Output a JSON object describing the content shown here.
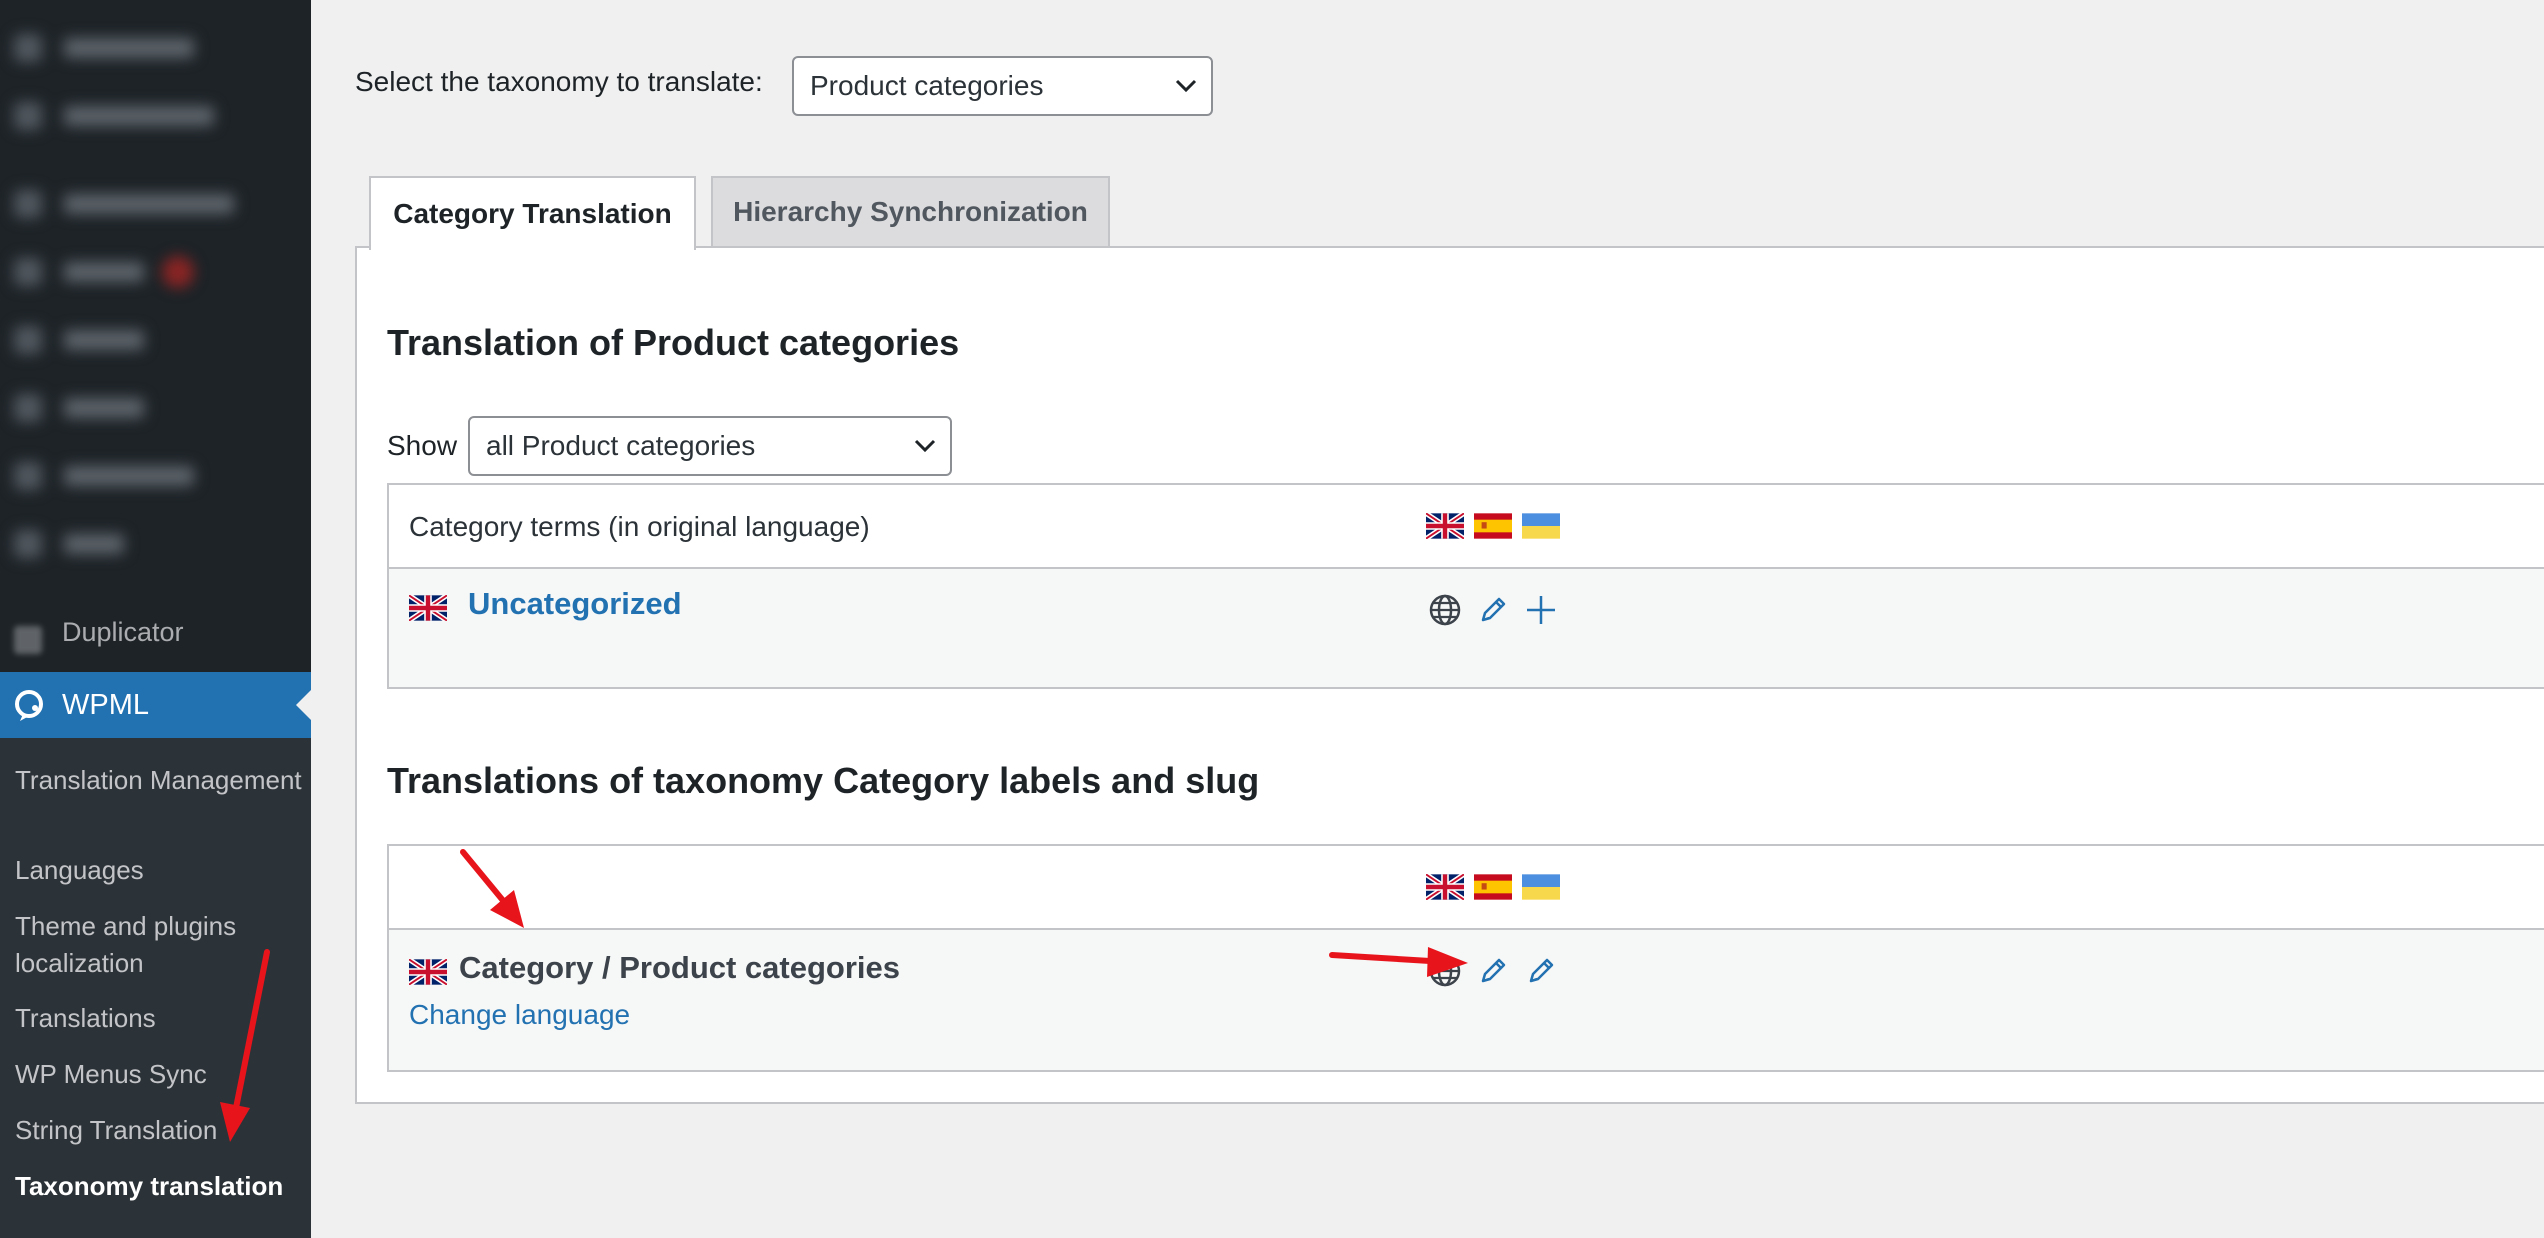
{
  "sidebar": {
    "duplicator_label": "Duplicator",
    "wpml_label": "WPML",
    "submenu": [
      {
        "label": "Translation Management"
      },
      {
        "label": "Languages"
      },
      {
        "label": "Theme and plugins localization"
      },
      {
        "label": "Translations"
      },
      {
        "label": "WP Menus Sync"
      },
      {
        "label": "String Translation"
      },
      {
        "label": "Taxonomy translation",
        "current": true
      }
    ]
  },
  "taxonomy_picker": {
    "label": "Select the taxonomy to translate:",
    "selected": "Product categories"
  },
  "tabs": [
    {
      "label": "Category Translation",
      "active": true
    },
    {
      "label": "Hierarchy Synchronization",
      "active": false
    }
  ],
  "terms_section": {
    "heading": "Translation of Product categories",
    "show_label": "Show",
    "filter_selected": "all Product categories",
    "column_header": "Category terms (in original language)",
    "rows": [
      {
        "term": "Uncategorized"
      }
    ]
  },
  "labels_section": {
    "heading": "Translations of taxonomy Category labels and slug",
    "row_label": "Category / Product categories",
    "change_language": "Change language"
  },
  "languages": [
    "en",
    "es",
    "uk"
  ],
  "icons": {
    "globe": "globe-icon",
    "pencil": "pencil-icon",
    "plus": "plus-icon",
    "chevron": "chevron-down-icon"
  },
  "colors": {
    "sidebar_bg": "#1d2327",
    "submenu_bg": "#2c3338",
    "wpml_active": "#2271b1",
    "link": "#2271b1",
    "annotation_arrow": "#e8141c"
  }
}
